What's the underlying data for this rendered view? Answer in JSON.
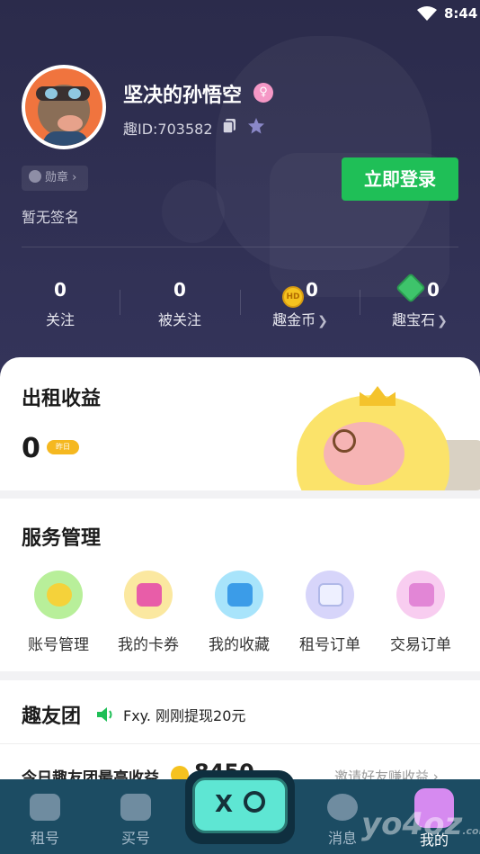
{
  "status_bar": {
    "time": "8:44",
    "wifi_icon": "wifi-icon"
  },
  "profile": {
    "username": "坚决的孙悟空",
    "gender_icon": "female-icon",
    "uid": "趣ID:703582",
    "badge_label": "勋章 ›",
    "signature": "暂无签名",
    "login_button": "立即登录"
  },
  "stats": [
    {
      "value": "0",
      "label": "关注"
    },
    {
      "value": "0",
      "label": "被关注"
    },
    {
      "value": "0",
      "label": "趣金币",
      "icon": "coin-icon",
      "arrow": true
    },
    {
      "value": "0",
      "label": "趣宝石",
      "icon": "gem-icon",
      "arrow": true
    }
  ],
  "rent_income": {
    "title": "出租收益",
    "value": "0",
    "badge": "昨日"
  },
  "service": {
    "title": "服务管理",
    "items": [
      {
        "label": "账号管理",
        "icon": "account-manage-icon",
        "color": "#7ed957"
      },
      {
        "label": "我的卡券",
        "icon": "coupon-icon",
        "color": "#f7d25c"
      },
      {
        "label": "我的收藏",
        "icon": "favorite-icon",
        "color": "#5cc8f0"
      },
      {
        "label": "租号订单",
        "icon": "rent-order-icon",
        "color": "#b7b4f2"
      },
      {
        "label": "交易订单",
        "icon": "trade-order-icon",
        "color": "#f1a3e1"
      }
    ]
  },
  "friends": {
    "title": "趣友团",
    "news": "Fxy. 刚刚提现20元",
    "today_label": "今日趣友团最高收益",
    "today_value": "8450",
    "invite": "邀请好友赚收益 ›"
  },
  "tabbar": {
    "items": [
      {
        "label": "租号",
        "icon": "gamepad-icon"
      },
      {
        "label": "买号",
        "icon": "shopping-bag-icon"
      },
      {
        "label": "消息",
        "icon": "message-icon"
      },
      {
        "label": "我的",
        "icon": "profile-icon"
      }
    ]
  },
  "watermark": "yo4oz.com",
  "colors": {
    "hero_bg": "#2f2f52",
    "login_green": "#1fbf57",
    "tabbar_bg": "#1c4c63"
  }
}
